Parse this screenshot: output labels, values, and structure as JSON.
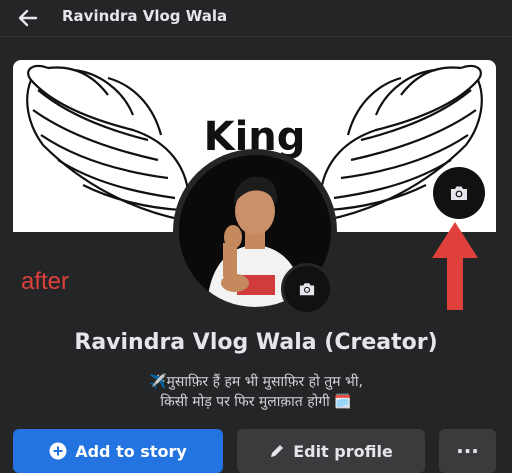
{
  "header": {
    "title": "Ravindra Vlog Wala",
    "back_icon": "arrow-left-icon"
  },
  "cover": {
    "text": "King"
  },
  "annotation": {
    "label": "after",
    "color": "#e0403c"
  },
  "profile": {
    "name": "Ravindra Vlog Wala (Creator)",
    "bio_line1": "✈️मुसाफ़िर हैं हम भी मुसाफ़िर हो तुम भी,",
    "bio_line2": "किसी मोड़ पर फिर मुलाक़ात होगी 🗓️"
  },
  "actions": {
    "add_story": "Add to story",
    "edit_profile": "Edit profile",
    "more": "···"
  },
  "colors": {
    "accent": "#2374e1",
    "background": "#242526",
    "button_secondary": "#3a3b3c"
  }
}
